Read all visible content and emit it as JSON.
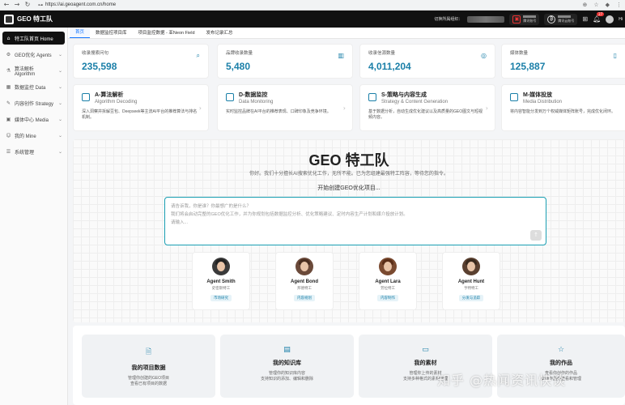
{
  "browser": {
    "url": "https://ai.geoagent.com.cn/home"
  },
  "header": {
    "title": "GEO 特工队",
    "switch_label": "切换所属组织：",
    "account1": "腾讯账号",
    "account2": "腾讯云账号",
    "badge": "27",
    "user": "Hi"
  },
  "sidebar": {
    "items": [
      {
        "label": "特工队首页 Home",
        "icon": "home-icon",
        "active": true
      },
      {
        "label": "GEO优化 Agents",
        "icon": "agents-icon"
      },
      {
        "label": "算法解析 Algorithm",
        "icon": "algorithm-icon"
      },
      {
        "label": "数据监控 Data",
        "icon": "data-icon"
      },
      {
        "label": "内容创作 Strategy",
        "icon": "strategy-icon"
      },
      {
        "label": "媒体中心 Media",
        "icon": "media-icon"
      },
      {
        "label": "我的 Mine",
        "icon": "user-icon"
      },
      {
        "label": "系统管理",
        "icon": "settings-icon"
      }
    ]
  },
  "tabs": [
    "首页",
    "数据监控项目库",
    "项目监控数据 - 亚Neon Field",
    "发布记录汇总"
  ],
  "stats": [
    {
      "label": "收录搜索问句",
      "value": "235,598",
      "icon": "search-doc-icon"
    },
    {
      "label": "品牌收录数量",
      "value": "5,480",
      "icon": "chart-icon"
    },
    {
      "label": "收录信源数量",
      "value": "4,011,204",
      "icon": "signal-icon"
    },
    {
      "label": "媒体数量",
      "value": "125,887",
      "icon": "media-icon"
    }
  ],
  "features": [
    {
      "title": "A-算法解析",
      "subtitle": "Algorithm Decoding",
      "desc": "深入洞察并拆解豆包、Deepseek等主流AI平台的推荐算法与排名机制。"
    },
    {
      "title": "D-数据监控",
      "subtitle": "Data Monitoring",
      "desc": "实时监控品牌在AI平台的推荐表现、口碑印象及竞争环境。"
    },
    {
      "title": "S-策略与内容生成",
      "subtitle": "Strategy & Content Generation",
      "desc": "基于数据分析，自动生成优化建议以及高质量的GEO图文与短视频内容。"
    },
    {
      "title": "M-媒体投放",
      "subtitle": "Media Distribution",
      "desc": "将内容智能分发到万个权威媒体矩阵账号，完成优化闭环。"
    }
  ],
  "hero": {
    "title": "GEO 特工队",
    "subtitle": "你好。我们十分擅长AI搜索优化工作，无所不能。已为您组建最强特工阵容，等待您的指令。",
    "start": "开始创建GEO优化项目...",
    "placeholder_lines": [
      "请告诉我，你是谁？你最想广的是什么？",
      "我们将会启动完整的GEO优化工作，并为你规划包括数据监控分析、优化策略建议、定时内容生产计划和媒介投放计划。",
      "请输入..."
    ]
  },
  "agents": [
    {
      "name": "Agent Smith",
      "role": "史密斯特工",
      "tag": "市场研究"
    },
    {
      "name": "Agent Bond",
      "role": "邦德特工",
      "tag": "内容规划"
    },
    {
      "name": "Agent Lara",
      "role": "劳拉特工",
      "tag": "内容制作"
    },
    {
      "name": "Agent Hunt",
      "role": "亨特特工",
      "tag": "分发与追踪"
    }
  ],
  "bottom_cards": [
    {
      "title": "我的项目数据",
      "desc1": "管理你创建的GEO项目",
      "desc2": "查看已有项目的数据",
      "icon": "doc-check-icon"
    },
    {
      "title": "我的知识库",
      "desc1": "管理你的知识库内容",
      "desc2": "支持知识的添加、编辑和删除",
      "icon": "book-icon"
    },
    {
      "title": "我的素材",
      "desc1": "管理你上传的素材",
      "desc2": "支持多种格式的素材管理",
      "icon": "folder-icon"
    },
    {
      "title": "我的作品",
      "desc1": "查看你创作的作品",
      "desc2": "支持作品的查看和管理",
      "icon": "star-icon"
    }
  ],
  "watermark": "知乎 @热闻资讯快谈"
}
